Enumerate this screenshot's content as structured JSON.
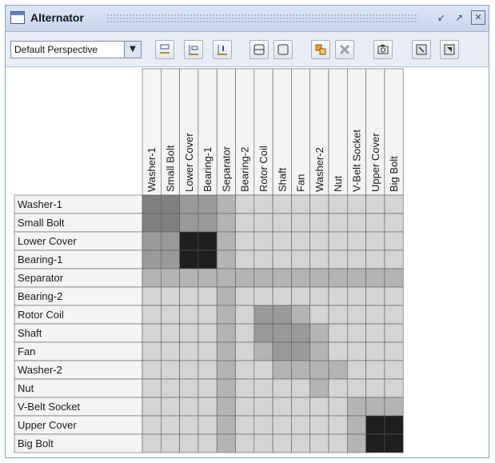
{
  "window": {
    "title": "Alternator"
  },
  "toolbar": {
    "perspective": {
      "selected": "Default Perspective"
    },
    "buttons": [
      {
        "name": "sort-icon"
      },
      {
        "name": "align-top-icon"
      },
      {
        "name": "info-bar-icon"
      },
      {
        "name": "split-horizontal-icon"
      },
      {
        "name": "frame-icon"
      },
      {
        "name": "cluster-icon"
      },
      {
        "name": "remove-cluster-icon"
      },
      {
        "name": "camera-icon"
      },
      {
        "name": "export-icon"
      },
      {
        "name": "settings-icon"
      }
    ]
  },
  "matrix": {
    "components": [
      "Washer-1",
      "Small Bolt",
      "Lower Cover",
      "Bearing-1",
      "Separator",
      "Bearing-2",
      "Rotor Coil",
      "Shaft",
      "Fan",
      "Washer-2",
      "Nut",
      "V-Belt Socket",
      "Upper Cover",
      "Big Bolt"
    ],
    "levels": [
      [
        3,
        3,
        2,
        2,
        1,
        0,
        0,
        0,
        0,
        0,
        0,
        0,
        0,
        0
      ],
      [
        3,
        3,
        2,
        2,
        1,
        0,
        0,
        0,
        0,
        0,
        0,
        0,
        0,
        0
      ],
      [
        2,
        2,
        4,
        4,
        1,
        0,
        0,
        0,
        0,
        0,
        0,
        0,
        0,
        0
      ],
      [
        2,
        2,
        4,
        4,
        1,
        0,
        0,
        0,
        0,
        0,
        0,
        0,
        0,
        0
      ],
      [
        1,
        1,
        1,
        1,
        1,
        1,
        1,
        1,
        1,
        1,
        1,
        1,
        1,
        1
      ],
      [
        0,
        0,
        0,
        0,
        1,
        0,
        0,
        0,
        0,
        0,
        0,
        0,
        0,
        0
      ],
      [
        0,
        0,
        0,
        0,
        1,
        0,
        2,
        2,
        1,
        0,
        0,
        0,
        0,
        0
      ],
      [
        0,
        0,
        0,
        0,
        1,
        0,
        2,
        2,
        2,
        1,
        0,
        0,
        0,
        0
      ],
      [
        0,
        0,
        0,
        0,
        1,
        0,
        1,
        2,
        2,
        1,
        0,
        0,
        0,
        0
      ],
      [
        0,
        0,
        0,
        0,
        1,
        0,
        0,
        1,
        1,
        1,
        1,
        0,
        0,
        0
      ],
      [
        0,
        0,
        0,
        0,
        1,
        0,
        0,
        0,
        0,
        1,
        0,
        0,
        0,
        0
      ],
      [
        0,
        0,
        0,
        0,
        1,
        0,
        0,
        0,
        0,
        0,
        0,
        1,
        1,
        1
      ],
      [
        0,
        0,
        0,
        0,
        1,
        0,
        0,
        0,
        0,
        0,
        0,
        1,
        4,
        4
      ],
      [
        0,
        0,
        0,
        0,
        1,
        0,
        0,
        0,
        0,
        0,
        0,
        1,
        4,
        4
      ]
    ],
    "colors": {
      "level0": "#d4d4d4",
      "level1": "#b4b4b4",
      "level2": "#9a9a9a",
      "level3": "#808080",
      "level4": "#1e1e1e",
      "label_bg": "#f4f4f4",
      "grid": "#5a5a5a"
    }
  }
}
